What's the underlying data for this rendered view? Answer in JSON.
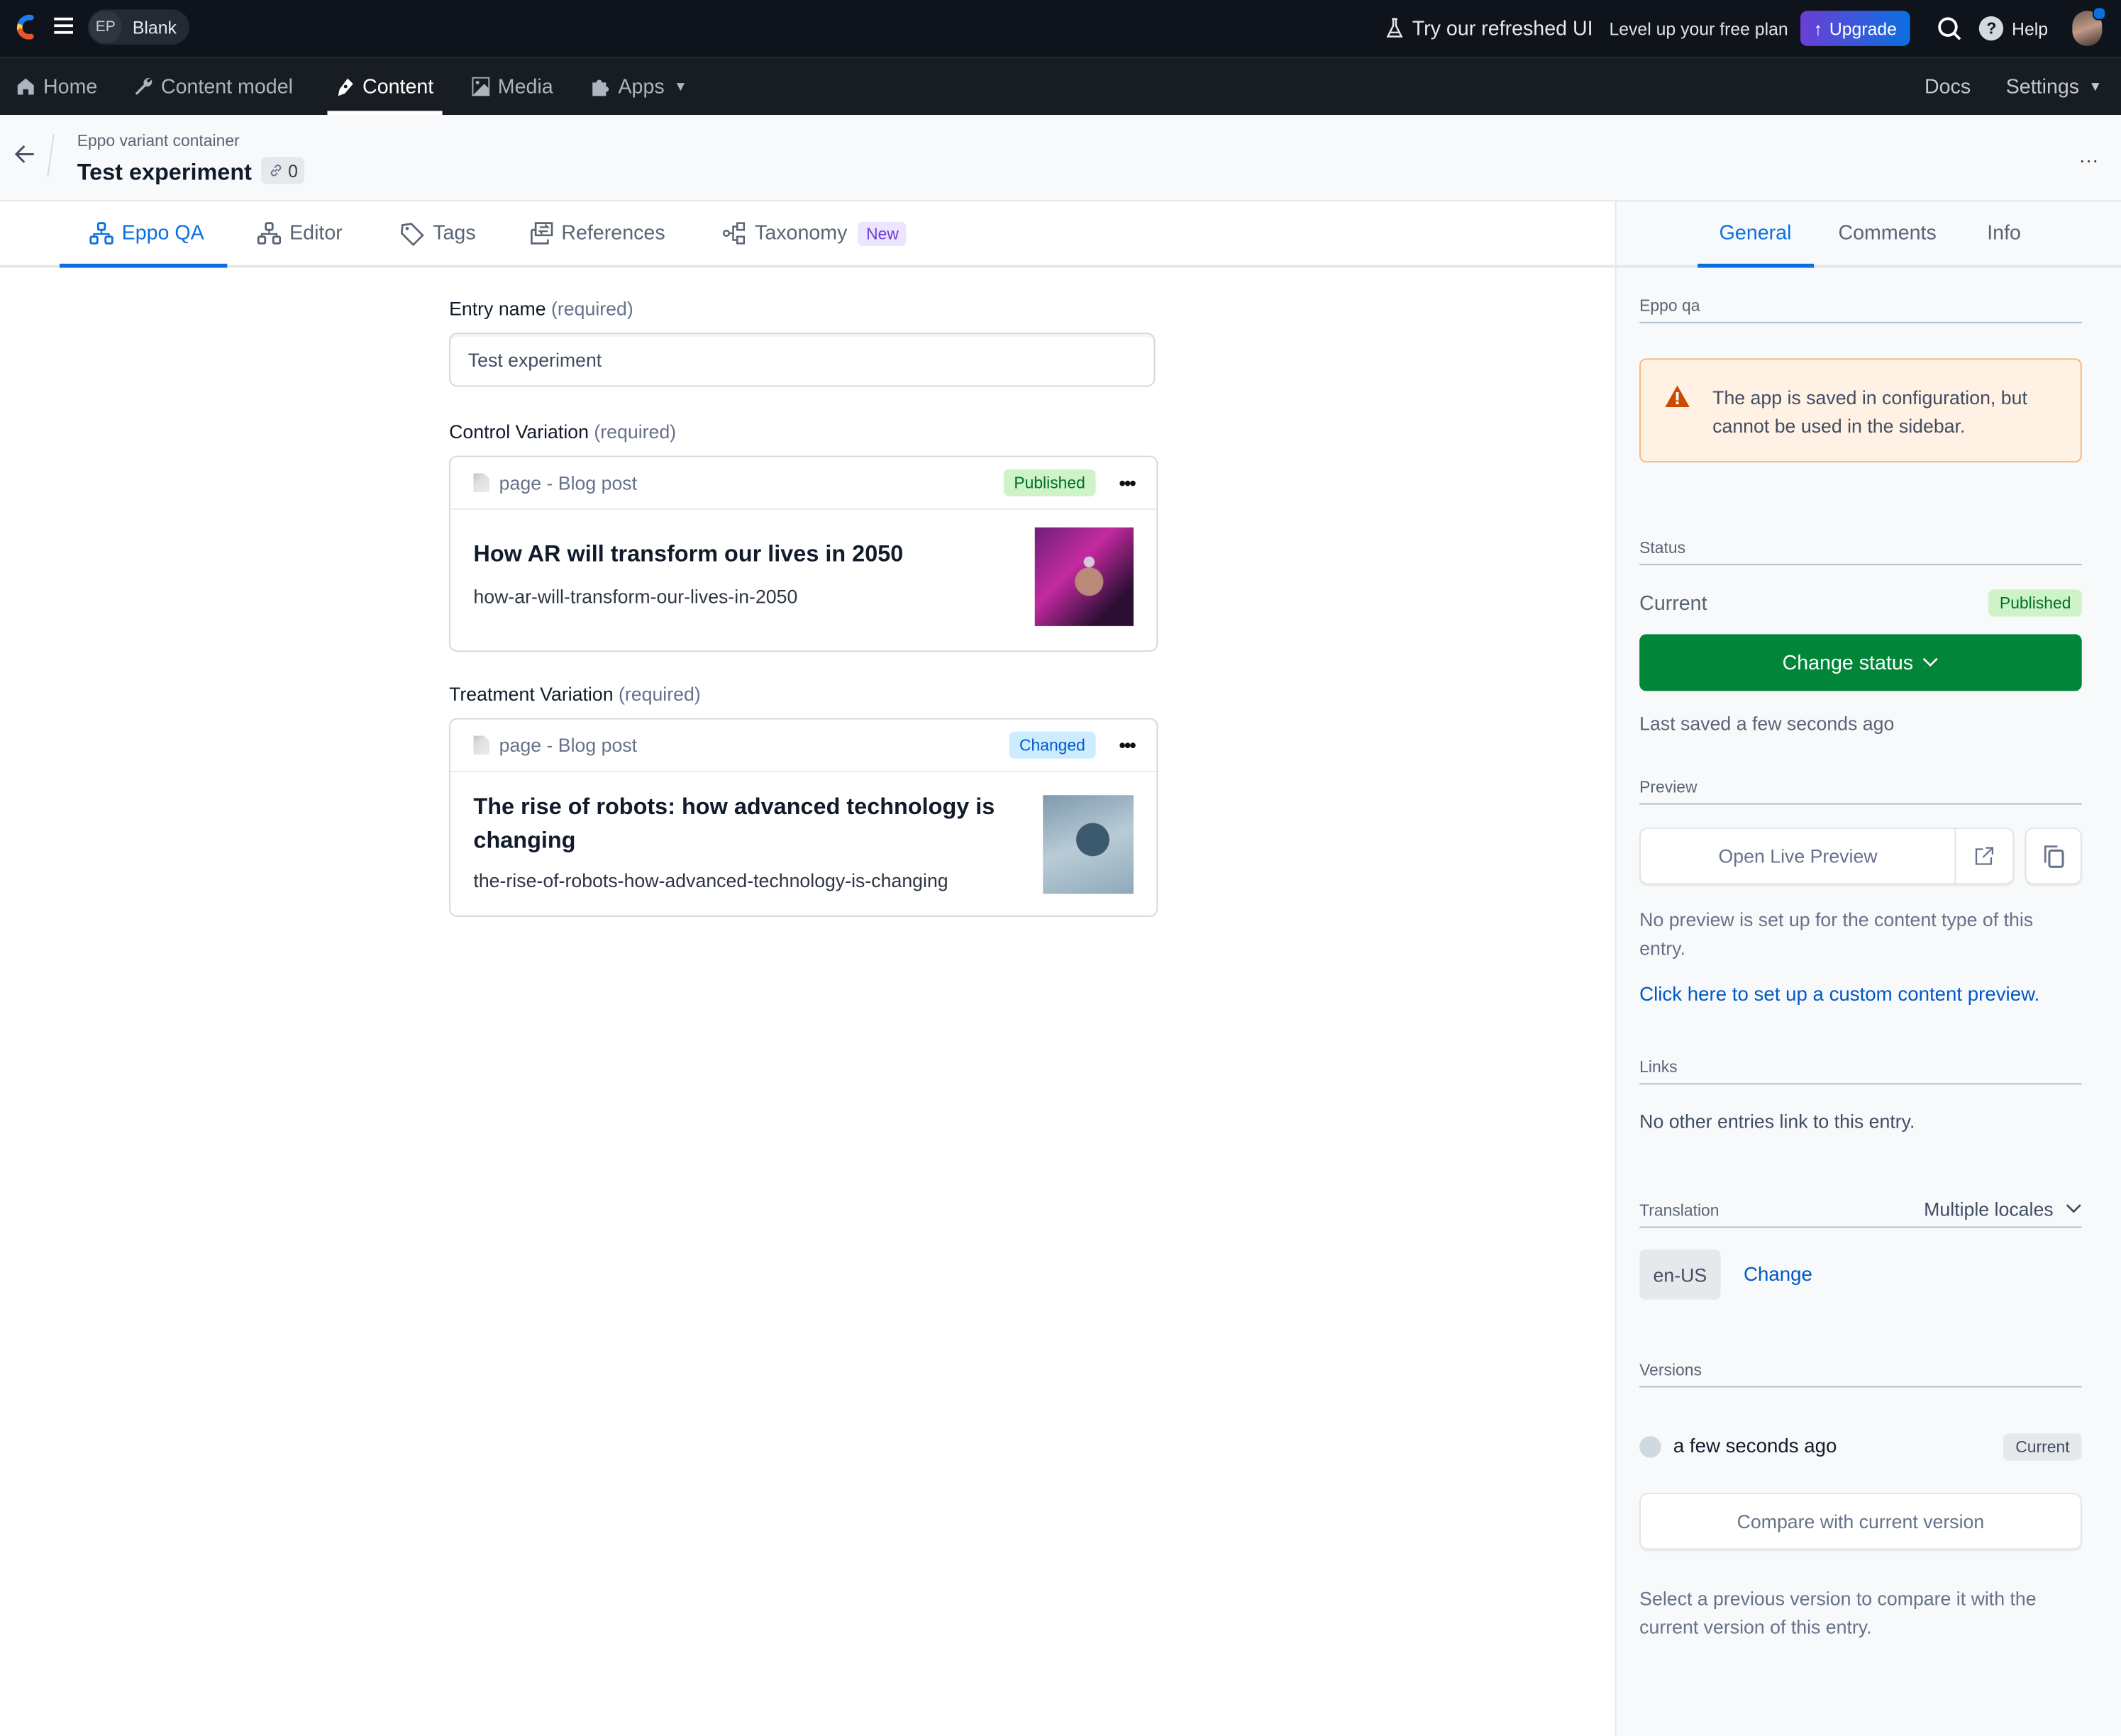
{
  "topbar": {
    "space_initials": "EP",
    "space_name": "Blank",
    "try_refreshed": "Try our refreshed UI",
    "level_up": "Level up your free plan",
    "upgrade_label": "Upgrade",
    "help_label": "Help"
  },
  "nav": {
    "items": [
      {
        "label": "Home",
        "icon": "home-icon"
      },
      {
        "label": "Content model",
        "icon": "wrench-icon"
      },
      {
        "label": "Content",
        "icon": "pen-icon",
        "active": true
      },
      {
        "label": "Media",
        "icon": "image-icon"
      },
      {
        "label": "Apps",
        "icon": "puzzle-icon"
      }
    ],
    "docs_label": "Docs",
    "settings_label": "Settings"
  },
  "entry": {
    "content_type": "Eppo variant container",
    "title": "Test experiment",
    "reference_count": "0",
    "more_label": "..."
  },
  "tabs": [
    {
      "label": "Eppo QA",
      "active": true
    },
    {
      "label": "Editor"
    },
    {
      "label": "Tags"
    },
    {
      "label": "References"
    },
    {
      "label": "Taxonomy",
      "badge": "New"
    }
  ],
  "form": {
    "required_suffix": "(required)",
    "entry_name_label": "Entry name",
    "entry_name_value": "Test experiment",
    "control_label": "Control Variation",
    "treatment_label": "Treatment Variation",
    "control": {
      "type_label": "page - Blog post",
      "status": "Published",
      "title": "How AR will transform our lives in 2050",
      "slug": "how-ar-will-transform-our-lives-in-2050"
    },
    "treatment": {
      "type_label": "page - Blog post",
      "status": "Changed",
      "title": "The rise of robots: how advanced technology is changing",
      "slug": "the-rise-of-robots-how-advanced-technology-is-changing"
    },
    "menu_label": "•••"
  },
  "sidebar": {
    "tabs": [
      "General",
      "Comments",
      "Info"
    ],
    "app_heading": "Eppo qa",
    "warning": "The app is saved in configuration, but cannot be used in the sidebar.",
    "status_heading": "Status",
    "current_label": "Current",
    "current_status": "Published",
    "change_status": "Change status",
    "last_saved": "Last saved a few seconds ago",
    "preview_heading": "Preview",
    "open_live_preview": "Open Live Preview",
    "no_preview": "No preview is set up for the content type of this entry.",
    "custom_preview_link": "Click here to set up a custom content preview.",
    "links_heading": "Links",
    "no_links": "No other entries link to this entry.",
    "translation_heading": "Translation",
    "locales_select": "Multiple locales",
    "locale": "en-US",
    "change_locale": "Change",
    "versions_heading": "Versions",
    "version_time": "a few seconds ago",
    "version_badge": "Current",
    "compare_button": "Compare with current version",
    "compare_hint": "Select a previous version to compare it with the current version of this entry."
  },
  "colors": {
    "accent": "#0b6fe0",
    "primary_green": "#008539",
    "published_bg": "#cdf3c6",
    "changed_bg": "#ceecff",
    "warning_bg": "#fff2e4",
    "topbar_bg": "#0f141c"
  }
}
